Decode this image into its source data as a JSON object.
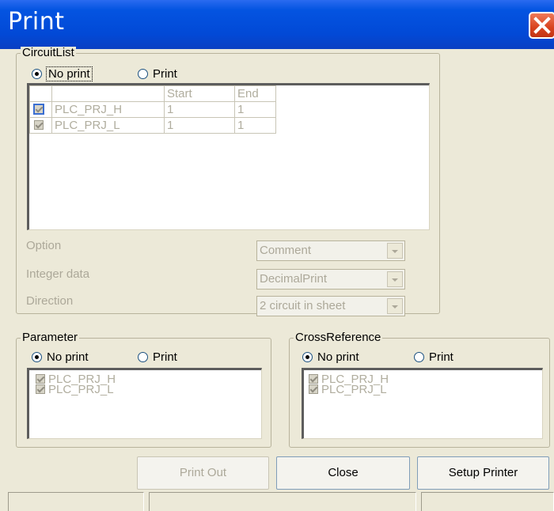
{
  "window": {
    "title": "Print"
  },
  "circuit_list": {
    "legend": "CircuitList",
    "no_print_label": "No print",
    "print_label": "Print",
    "selected": "no_print",
    "columns": [
      "",
      "Start",
      "End"
    ],
    "rows": [
      {
        "name": "PLC_PRJ_H",
        "start": "1",
        "end": "1",
        "checked": true
      },
      {
        "name": "PLC_PRJ_L",
        "start": "1",
        "end": "1",
        "checked": true
      }
    ],
    "option_label": "Option",
    "option_value": "Comment",
    "integer_label": "Integer data",
    "integer_value": "DecimalPrint",
    "direction_label": "Direction",
    "direction_value": "2 circuit in sheet"
  },
  "parameter": {
    "legend": "Parameter",
    "no_print_label": "No print",
    "print_label": "Print",
    "selected": "no_print",
    "items": [
      "PLC_PRJ_H",
      "PLC_PRJ_L"
    ]
  },
  "cross_reference": {
    "legend": "CrossReference",
    "no_print_label": "No print",
    "print_label": "Print",
    "selected": "no_print",
    "items": [
      "PLC_PRJ_H",
      "PLC_PRJ_L"
    ]
  },
  "buttons": {
    "print_out": "Print Out",
    "close": "Close",
    "setup_printer": "Setup Printer"
  }
}
